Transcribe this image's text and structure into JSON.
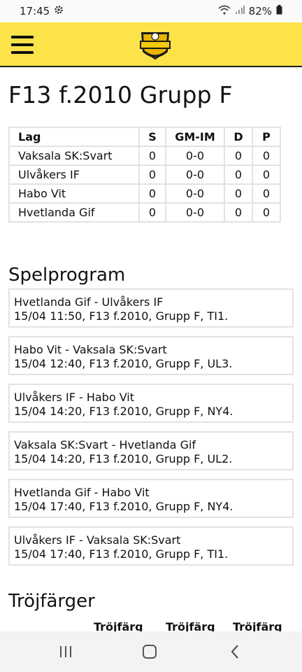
{
  "status": {
    "time": "17:45",
    "battery": "82%"
  },
  "header": {
    "menu_icon": "hamburger-menu-icon",
    "logo_icon": "cup-logo-badge",
    "accent_color": "#fce34a"
  },
  "page": {
    "title": "F13 f.2010 Grupp F"
  },
  "standings": {
    "headers": [
      "Lag",
      "S",
      "GM-IM",
      "D",
      "P"
    ],
    "rows": [
      {
        "team": "Vaksala SK:Svart",
        "s": "0",
        "gm_im": "0-0",
        "d": "0",
        "p": "0"
      },
      {
        "team": "Ulvåkers IF",
        "s": "0",
        "gm_im": "0-0",
        "d": "0",
        "p": "0"
      },
      {
        "team": "Habo Vit",
        "s": "0",
        "gm_im": "0-0",
        "d": "0",
        "p": "0"
      },
      {
        "team": "Hvetlanda Gif",
        "s": "0",
        "gm_im": "0-0",
        "d": "0",
        "p": "0"
      }
    ]
  },
  "schedule": {
    "heading": "Spelprogram",
    "matches": [
      {
        "teams": "Hvetlanda Gif - Ulvåkers IF",
        "details": "15/04 11:50, F13 f.2010, Grupp F, TI1."
      },
      {
        "teams": "Habo Vit - Vaksala SK:Svart",
        "details": "15/04 12:40, F13 f.2010, Grupp F, UL3."
      },
      {
        "teams": "Ulvåkers IF - Habo Vit",
        "details": "15/04 14:20, F13 f.2010, Grupp F, NY4."
      },
      {
        "teams": "Vaksala SK:Svart - Hvetlanda Gif",
        "details": "15/04 14:20, F13 f.2010, Grupp F, UL2."
      },
      {
        "teams": "Hvetlanda Gif - Habo Vit",
        "details": "15/04 17:40, F13 f.2010, Grupp F, NY4."
      },
      {
        "teams": "Ulvåkers IF - Vaksala SK:Svart",
        "details": "15/04 17:40, F13 f.2010, Grupp F, TI1."
      }
    ]
  },
  "kits": {
    "heading": "Tröjfärger",
    "columns": [
      "Tröjfärg",
      "Tröjfärg",
      "Tröjfärg"
    ]
  },
  "nav": {
    "recents_icon": "recents-icon",
    "home_icon": "home-icon",
    "back_icon": "back-icon"
  }
}
